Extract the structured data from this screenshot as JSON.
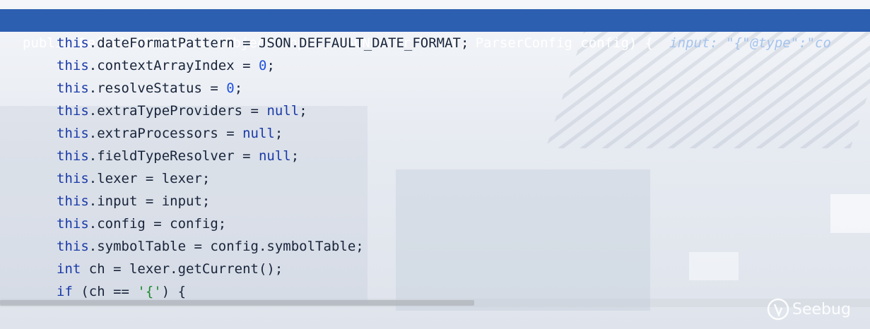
{
  "editor": {
    "header_line": {
      "code": "public DefaultJSONParser(Object input, JSONLexer lexer, ParserConfig config) {",
      "inline_hint": "input: \"{\"@type\":\"co"
    },
    "lines": [
      [
        {
          "t": "this",
          "c": "kw"
        },
        {
          "t": ".dateFormatPattern = JSON.DEFFAULT_DATE_FORMAT;"
        }
      ],
      [
        {
          "t": "this",
          "c": "kw"
        },
        {
          "t": ".contextArrayIndex = "
        },
        {
          "t": "0",
          "c": "num"
        },
        {
          "t": ";"
        }
      ],
      [
        {
          "t": "this",
          "c": "kw"
        },
        {
          "t": ".resolveStatus = "
        },
        {
          "t": "0",
          "c": "num"
        },
        {
          "t": ";"
        }
      ],
      [
        {
          "t": "this",
          "c": "kw"
        },
        {
          "t": ".extraTypeProviders = "
        },
        {
          "t": "null",
          "c": "kw"
        },
        {
          "t": ";"
        }
      ],
      [
        {
          "t": "this",
          "c": "kw"
        },
        {
          "t": ".extraProcessors = "
        },
        {
          "t": "null",
          "c": "kw"
        },
        {
          "t": ";"
        }
      ],
      [
        {
          "t": "this",
          "c": "kw"
        },
        {
          "t": ".fieldTypeResolver = "
        },
        {
          "t": "null",
          "c": "kw"
        },
        {
          "t": ";"
        }
      ],
      [
        {
          "t": "this",
          "c": "kw"
        },
        {
          "t": ".lexer = lexer;"
        }
      ],
      [
        {
          "t": "this",
          "c": "kw"
        },
        {
          "t": ".input = input;"
        }
      ],
      [
        {
          "t": "this",
          "c": "kw"
        },
        {
          "t": ".config = config;"
        }
      ],
      [
        {
          "t": "this",
          "c": "kw"
        },
        {
          "t": ".symbolTable = config.symbolTable;"
        }
      ],
      [
        {
          "t": "int",
          "c": "kw"
        },
        {
          "t": " ch = lexer.getCurrent();"
        }
      ],
      [
        {
          "t": "if",
          "c": "kw"
        },
        {
          "t": " (ch == "
        },
        {
          "t": "'{'",
          "c": "str"
        },
        {
          "t": ") {"
        }
      ]
    ]
  },
  "watermark": {
    "text": "Seebug"
  },
  "colors": {
    "highlight": "#2d5fb1",
    "keyword": "#1a3aa8",
    "number": "#1f52e0",
    "string": "#1a8a2a"
  }
}
